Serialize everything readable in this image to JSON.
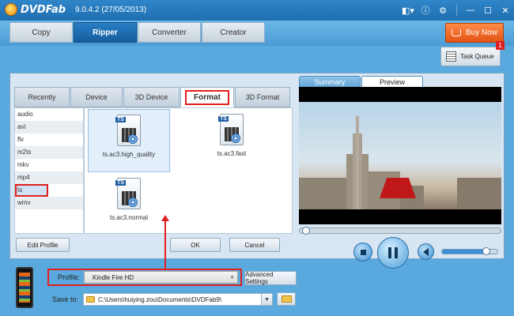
{
  "app": {
    "name": "DVDFab",
    "version": "9.0.4.2 (27/05/2013)"
  },
  "main_tabs": [
    {
      "label": "Copy",
      "active": false
    },
    {
      "label": "Ripper",
      "active": true
    },
    {
      "label": "Converter",
      "active": false
    },
    {
      "label": "Creator",
      "active": false
    }
  ],
  "buy_now_label": "Buy Now",
  "task_queue": {
    "label": "Task Queue",
    "badge": "1"
  },
  "format_tabs": [
    {
      "label": "Recently",
      "active": false
    },
    {
      "label": "Device",
      "active": false
    },
    {
      "label": "3D Device",
      "active": false
    },
    {
      "label": "Format",
      "active": true
    },
    {
      "label": "3D Format",
      "active": false
    }
  ],
  "formats": [
    "audio",
    "avi",
    "flv",
    "m2ts",
    "mkv",
    "mp4",
    "ts",
    "wmv"
  ],
  "selected_format": "ts",
  "profiles": [
    {
      "label": "ts.ac3.high_quality",
      "tag": "TS",
      "selected": true
    },
    {
      "label": "ts.ac3.fast",
      "tag": "TS",
      "selected": false
    },
    {
      "label": "ts.ac3.normal",
      "tag": "TS",
      "selected": false
    }
  ],
  "buttons": {
    "edit_profile": "Edit Profile",
    "ok": "OK",
    "cancel": "Cancel",
    "advanced_settings": "Advanced Settings"
  },
  "preview_tabs": [
    {
      "label": "Summary",
      "active": false
    },
    {
      "label": "Preview",
      "active": true
    }
  ],
  "playback": {
    "progress": 0.0,
    "volume": 0.78
  },
  "profile_field": {
    "label": "Profile:",
    "value": "Kindle Fire HD"
  },
  "save_to": {
    "label": "Save to:",
    "value": "C:\\Users\\huiying.zou\\Documents\\DVDFab9\\"
  },
  "colors": {
    "accent": "#1f6fb0",
    "buy": "#e35312",
    "highlight": "#e02020"
  }
}
